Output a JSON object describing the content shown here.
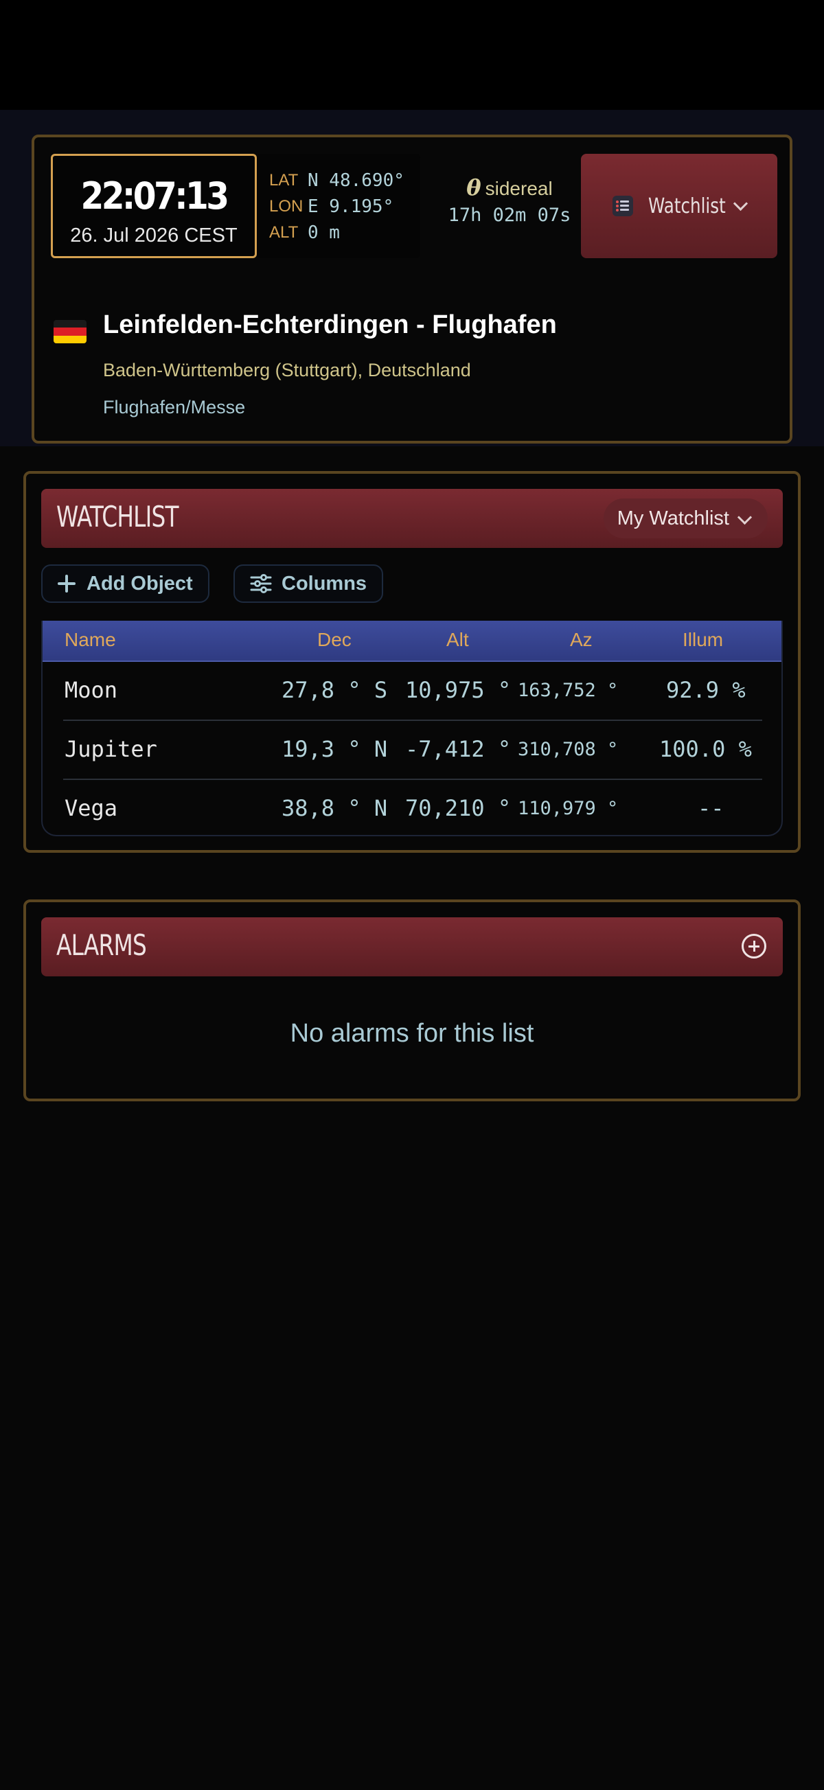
{
  "header": {
    "clock": {
      "time": "22:07:13",
      "date": "26. Jul 2026  CEST"
    },
    "coords": [
      {
        "key": "LAT",
        "value": "N 48.690°"
      },
      {
        "key": "LON",
        "value": "E 9.195°"
      },
      {
        "key": "ALT",
        "value": "0 m"
      }
    ],
    "sidereal": {
      "symbol": "θ",
      "label": "sidereal",
      "value": "17h 02m 07s"
    },
    "watchlist_button": {
      "label": "Watchlist",
      "icon": "watchlist-icon"
    },
    "location": {
      "flag": "germany-flag",
      "title": "Leinfelden-Echterdingen - Flughafen",
      "region": "Baden-Württemberg (Stuttgart), Deutschland",
      "place": "Flughafen/Messe"
    }
  },
  "watchlist": {
    "title": "WATCHLIST",
    "selected_list": "My Watchlist",
    "add_button": "Add Object",
    "columns_button": "Columns",
    "columns": [
      "Name",
      "Dec",
      "Alt",
      "Az",
      "Illum"
    ],
    "rows": [
      {
        "name": "Moon",
        "dec": "27,8 ° S",
        "alt": "10,975 °",
        "az": "163,752 °",
        "illum": "92.9 %"
      },
      {
        "name": "Jupiter",
        "dec": "19,3 ° N",
        "alt": "-7,412 °",
        "az": "310,708 °",
        "illum": "100.0 %"
      },
      {
        "name": "Vega",
        "dec": "38,8 ° N",
        "alt": "70,210 °",
        "az": "110,979 °",
        "illum": "--"
      }
    ]
  },
  "alarms": {
    "title": "ALARMS",
    "empty_message": "No alarms for this list"
  },
  "colors": {
    "accent_gold": "#d4a050",
    "header_red": "#6a2329",
    "table_blue": "#36428e",
    "value_cyan": "#b3d3da"
  }
}
